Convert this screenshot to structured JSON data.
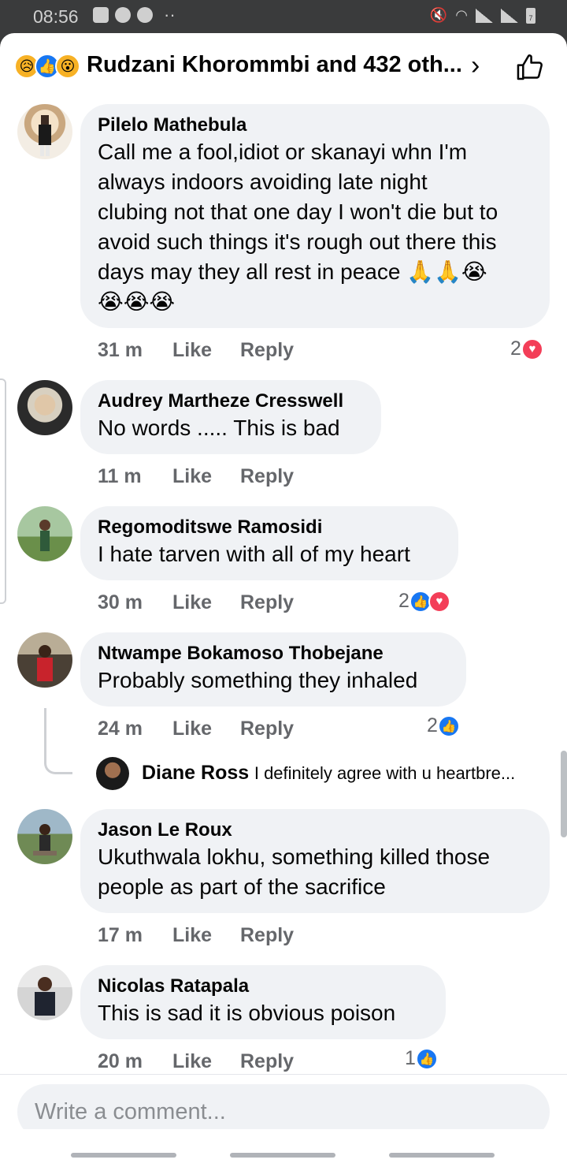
{
  "status_bar": {
    "time": "08:56",
    "battery": "7"
  },
  "header": {
    "title": "Rudzani Khorommbi and 432 oth..."
  },
  "comments": [
    {
      "author": "Pilelo Mathebula",
      "lines": [
        "Call me a fool,idiot or skanayi whn I'm",
        "always indoors avoiding late night",
        "clubing not that one day I won't die but to",
        "avoid such things it's rough out there this",
        "days may they all rest in peace 🙏🙏😭",
        "😭😭😭"
      ],
      "time": "31 m",
      "like": "Like",
      "reply": "Reply",
      "reactions": "2"
    },
    {
      "author": "Audrey Martheze Cresswell",
      "lines": [
        "No words ..... This is bad"
      ],
      "time": "11 m",
      "like": "Like",
      "reply": "Reply",
      "reactions": ""
    },
    {
      "author": "Regomoditswe Ramosidi",
      "lines": [
        "I hate tarven with all of my heart"
      ],
      "time": "30 m",
      "like": "Like",
      "reply": "Reply",
      "reactions": "2"
    },
    {
      "author": "Ntwampe Bokamoso Thobejane",
      "lines": [
        "Probably something they inhaled"
      ],
      "time": "24 m",
      "like": "Like",
      "reply": "Reply",
      "reactions": "2",
      "reply_preview": {
        "author": "Diane Ross",
        "text": "I definitely agree with u heartbre..."
      }
    },
    {
      "author": "Jason Le Roux",
      "lines": [
        "Ukuthwala lokhu, something killed those",
        "people as part of the sacrifice"
      ],
      "time": "17 m",
      "like": "Like",
      "reply": "Reply",
      "reactions": ""
    },
    {
      "author": "Nicolas Ratapala",
      "lines": [
        "This is sad it is obvious poison"
      ],
      "time": "20 m",
      "like": "Like",
      "reply": "Reply",
      "reactions": "1"
    }
  ],
  "composer": {
    "placeholder": "Write a comment..."
  },
  "colors": {
    "like_blue": "#1877f2",
    "love_red": "#f33e58",
    "bubble": "#f0f2f5",
    "meta_gray": "#65676b"
  }
}
